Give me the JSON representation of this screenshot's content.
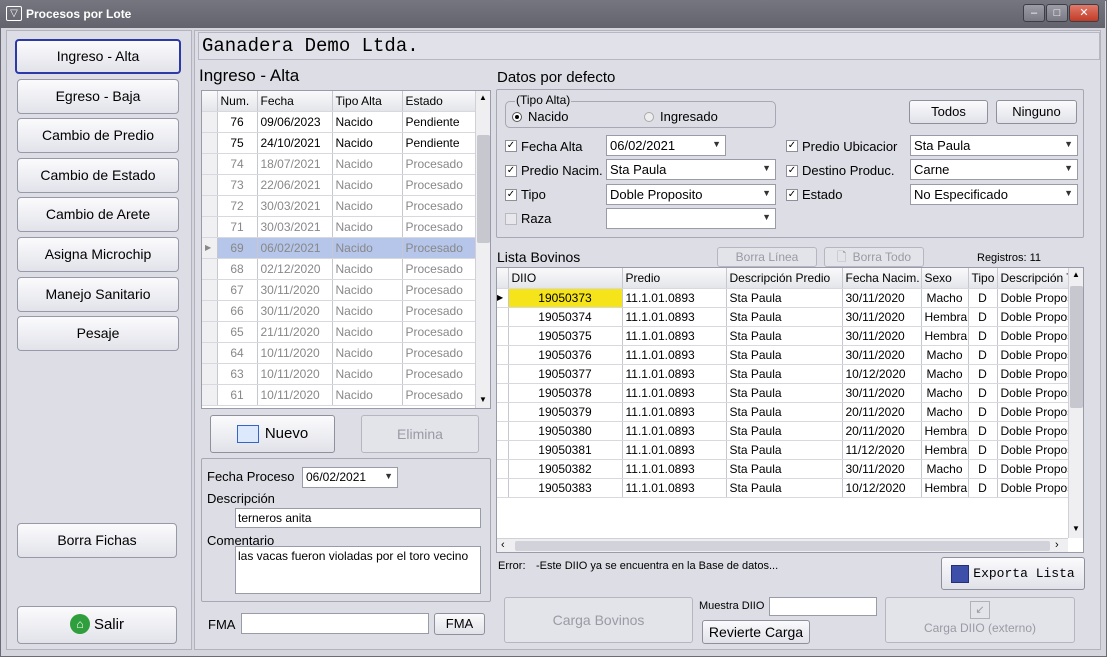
{
  "window": {
    "title": "Procesos por Lote",
    "icon": "bull-icon",
    "min": "–",
    "max": "□",
    "close": "✕"
  },
  "menu": {
    "items": [
      "Ingreso - Alta",
      "Egreso - Baja",
      "Cambio de Predio",
      "Cambio de Estado",
      "Cambio de Arete",
      "Asigna Microchip",
      "Manejo Sanitario",
      "Pesaje"
    ],
    "borra_fichas": "Borra Fichas",
    "salir": "Salir"
  },
  "company": "Ganadera Demo Ltda.",
  "section_title": "Ingreso - Alta",
  "lotes": {
    "columns": [
      "Num.",
      "Fecha",
      "Tipo Alta",
      "Estado"
    ],
    "rows": [
      [
        "76",
        "09/06/2023",
        "Nacido",
        "Pendiente"
      ],
      [
        "75",
        "24/10/2021",
        "Nacido",
        "Pendiente"
      ],
      [
        "74",
        "18/07/2021",
        "Nacido",
        "Procesado"
      ],
      [
        "73",
        "22/06/2021",
        "Nacido",
        "Procesado"
      ],
      [
        "72",
        "30/03/2021",
        "Nacido",
        "Procesado"
      ],
      [
        "71",
        "30/03/2021",
        "Nacido",
        "Procesado"
      ],
      [
        "69",
        "06/02/2021",
        "Nacido",
        "Procesado"
      ],
      [
        "68",
        "02/12/2020",
        "Nacido",
        "Procesado"
      ],
      [
        "67",
        "30/11/2020",
        "Nacido",
        "Procesado"
      ],
      [
        "66",
        "30/11/2020",
        "Nacido",
        "Procesado"
      ],
      [
        "65",
        "21/11/2020",
        "Nacido",
        "Procesado"
      ],
      [
        "64",
        "10/11/2020",
        "Nacido",
        "Procesado"
      ],
      [
        "63",
        "10/11/2020",
        "Nacido",
        "Procesado"
      ],
      [
        "61",
        "10/11/2020",
        "Nacido",
        "Procesado"
      ]
    ]
  },
  "buttons": {
    "nuevo": "Nuevo",
    "elimina": "Elimina",
    "fma": "FMA",
    "todos": "Todos",
    "ninguno": "Ninguno",
    "borra_linea": "Borra Línea",
    "borra_todo": "Borra Todo",
    "exporta": "Exporta Lista",
    "carga_bovinos": "Carga Bovinos",
    "revierte": "Revierte Carga",
    "carga_diio": "Carga DIIO (externo)"
  },
  "proceso": {
    "fecha_label": "Fecha Proceso",
    "fecha": "06/02/2021",
    "desc_label": "Descripción",
    "desc": "terneros anita",
    "coment_label": "Comentario",
    "coment": "las vacas fueron violadas por el toro vecino",
    "fma_label": "FMA",
    "fma_value": ""
  },
  "defaults": {
    "title": "Datos por defecto",
    "tipo_alta_label": "(Tipo Alta)",
    "radio_nacido": "Nacido",
    "radio_ingresado": "Ingresado",
    "fecha_alta_label": "Fecha Alta",
    "fecha_alta": "06/02/2021",
    "predio_nacim_label": "Predio Nacim.",
    "predio_nacim": "Sta Paula",
    "tipo_label": "Tipo",
    "tipo": "Doble Proposito",
    "raza_label": "Raza",
    "raza": "",
    "predio_ubic_label": "Predio Ubicacior",
    "predio_ubic": "Sta Paula",
    "destino_label": "Destino Produc.",
    "destino": "Carne",
    "estado_label": "Estado",
    "estado": "No Especificado"
  },
  "bovinos": {
    "title": "Lista Bovinos",
    "registros": "Registros: 11",
    "columns": [
      "DIIO",
      "Predio",
      "Descripción Predio",
      "Fecha Nacim.",
      "Sexo",
      "Tipo",
      "Descripción T"
    ],
    "rows": [
      [
        "19050373",
        "11.1.01.0893",
        "Sta Paula",
        "30/11/2020",
        "Macho",
        "D",
        "Doble Propos"
      ],
      [
        "19050374",
        "11.1.01.0893",
        "Sta Paula",
        "30/11/2020",
        "Hembra",
        "D",
        "Doble Propos"
      ],
      [
        "19050375",
        "11.1.01.0893",
        "Sta Paula",
        "30/11/2020",
        "Hembra",
        "D",
        "Doble Propos"
      ],
      [
        "19050376",
        "11.1.01.0893",
        "Sta Paula",
        "30/11/2020",
        "Macho",
        "D",
        "Doble Propos"
      ],
      [
        "19050377",
        "11.1.01.0893",
        "Sta Paula",
        "10/12/2020",
        "Macho",
        "D",
        "Doble Propos"
      ],
      [
        "19050378",
        "11.1.01.0893",
        "Sta Paula",
        "30/11/2020",
        "Macho",
        "D",
        "Doble Propos"
      ],
      [
        "19050379",
        "11.1.01.0893",
        "Sta Paula",
        "20/11/2020",
        "Macho",
        "D",
        "Doble Propos"
      ],
      [
        "19050380",
        "11.1.01.0893",
        "Sta Paula",
        "20/11/2020",
        "Hembra",
        "D",
        "Doble Propos"
      ],
      [
        "19050381",
        "11.1.01.0893",
        "Sta Paula",
        "11/12/2020",
        "Hembra",
        "D",
        "Doble Propos"
      ],
      [
        "19050382",
        "11.1.01.0893",
        "Sta Paula",
        "30/11/2020",
        "Macho",
        "D",
        "Doble Propos"
      ],
      [
        "19050383",
        "11.1.01.0893",
        "Sta Paula",
        "10/12/2020",
        "Hembra",
        "D",
        "Doble Propos"
      ]
    ]
  },
  "error": {
    "label": "Error:",
    "text": "-Este DIIO ya se encuentra en la Base de datos..."
  },
  "muestra": {
    "label": "Muestra DIIO",
    "value": ""
  },
  "colors": {
    "selected_row": "#b6c6ea",
    "highlight_cell": "#f5e41a",
    "menu_selected_border": "#2b3aa8"
  }
}
